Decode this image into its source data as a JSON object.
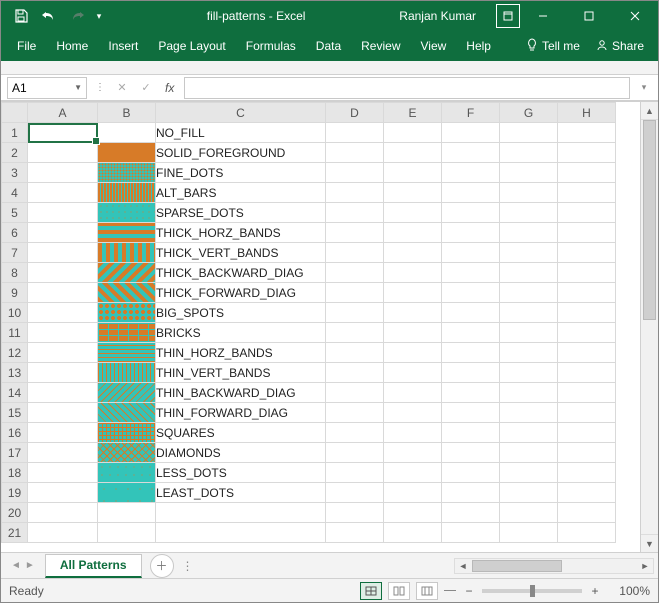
{
  "titlebar": {
    "doc_title": "fill-patterns  -  Excel",
    "user_name": "Ranjan Kumar"
  },
  "ribbon": {
    "tabs": [
      "File",
      "Home",
      "Insert",
      "Page Layout",
      "Formulas",
      "Data",
      "Review",
      "View",
      "Help"
    ],
    "tell_me": "Tell me",
    "share": "Share"
  },
  "formula_bar": {
    "name_box": "A1",
    "fx_label": "fx",
    "formula_value": ""
  },
  "grid": {
    "columns": [
      "A",
      "B",
      "C",
      "D",
      "E",
      "F",
      "G",
      "H"
    ],
    "row_count": 21,
    "selected_cell": "A1",
    "patterns": [
      {
        "row": 1,
        "label": "NO_FILL",
        "fg": "#d77b28",
        "bg": "#33c4b9",
        "type": "none"
      },
      {
        "row": 2,
        "label": "SOLID_FOREGROUND",
        "fg": "#d77b28",
        "bg": "#33c4b9",
        "type": "solid"
      },
      {
        "row": 3,
        "label": "FINE_DOTS",
        "fg": "#d77b28",
        "bg": "#33c4b9",
        "type": "finedots"
      },
      {
        "row": 4,
        "label": "ALT_BARS",
        "fg": "#d77b28",
        "bg": "#33c4b9",
        "type": "altbars"
      },
      {
        "row": 5,
        "label": "SPARSE_DOTS",
        "fg": "#d77b28",
        "bg": "#33c4b9",
        "type": "sparsedots"
      },
      {
        "row": 6,
        "label": "THICK_HORZ_BANDS",
        "fg": "#d77b28",
        "bg": "#33c4b9",
        "type": "thick-h"
      },
      {
        "row": 7,
        "label": "THICK_VERT_BANDS",
        "fg": "#d77b28",
        "bg": "#33c4b9",
        "type": "thick-v"
      },
      {
        "row": 8,
        "label": "THICK_BACKWARD_DIAG",
        "fg": "#d77b28",
        "bg": "#33c4b9",
        "type": "thick-bdiag"
      },
      {
        "row": 9,
        "label": "THICK_FORWARD_DIAG",
        "fg": "#d77b28",
        "bg": "#33c4b9",
        "type": "thick-fdiag"
      },
      {
        "row": 10,
        "label": "BIG_SPOTS",
        "fg": "#d77b28",
        "bg": "#33c4b9",
        "type": "bigspots"
      },
      {
        "row": 11,
        "label": "BRICKS",
        "fg": "#d77b28",
        "bg": "#33c4b9",
        "type": "bricks"
      },
      {
        "row": 12,
        "label": "THIN_HORZ_BANDS",
        "fg": "#d77b28",
        "bg": "#33c4b9",
        "type": "thin-h"
      },
      {
        "row": 13,
        "label": "THIN_VERT_BANDS",
        "fg": "#d77b28",
        "bg": "#33c4b9",
        "type": "thin-v"
      },
      {
        "row": 14,
        "label": "THIN_BACKWARD_DIAG",
        "fg": "#d77b28",
        "bg": "#33c4b9",
        "type": "thin-bdiag"
      },
      {
        "row": 15,
        "label": "THIN_FORWARD_DIAG",
        "fg": "#d77b28",
        "bg": "#33c4b9",
        "type": "thin-fdiag"
      },
      {
        "row": 16,
        "label": "SQUARES",
        "fg": "#d77b28",
        "bg": "#33c4b9",
        "type": "squares"
      },
      {
        "row": 17,
        "label": "DIAMONDS",
        "fg": "#d77b28",
        "bg": "#33c4b9",
        "type": "diamonds"
      },
      {
        "row": 18,
        "label": "LESS_DOTS",
        "fg": "#d77b28",
        "bg": "#33c4b9",
        "type": "lessdots"
      },
      {
        "row": 19,
        "label": "LEAST_DOTS",
        "fg": "#d77b28",
        "bg": "#33c4b9",
        "type": "leastdots"
      }
    ]
  },
  "sheet_tabs": {
    "active": "All Patterns"
  },
  "status": {
    "ready": "Ready",
    "zoom": "100%"
  }
}
